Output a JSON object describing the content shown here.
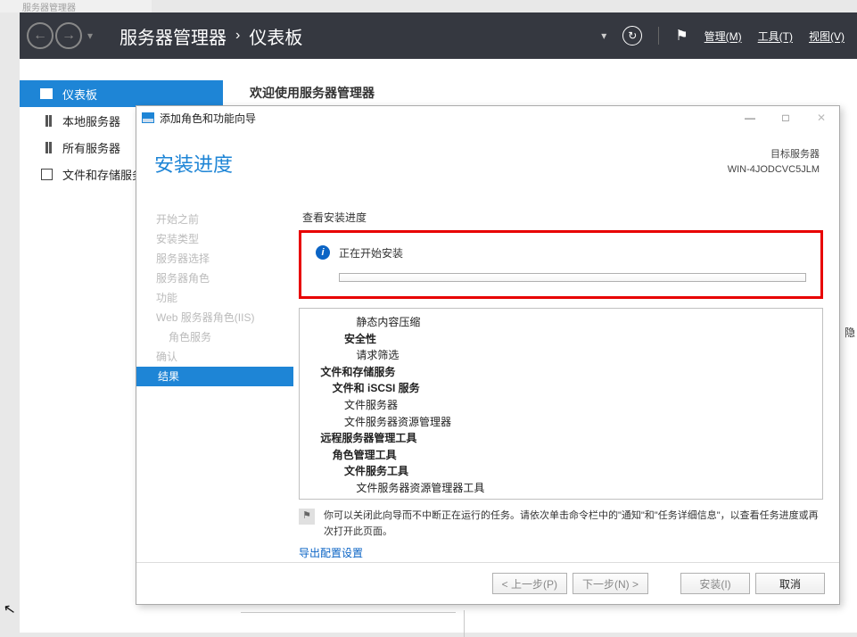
{
  "outerTitle": "服务器管理器",
  "breadcrumb": {
    "app": "服务器管理器",
    "page": "仪表板"
  },
  "headerMenu": {
    "manage": "管理(M)",
    "tools": "工具(T)",
    "view": "视图(V)"
  },
  "sidebar": {
    "items": [
      {
        "label": "仪表板"
      },
      {
        "label": "本地服务器"
      },
      {
        "label": "所有服务器"
      },
      {
        "label": "文件和存储服务"
      }
    ]
  },
  "content": {
    "welcome": "欢迎使用服务器管理器"
  },
  "dialog": {
    "title": "添加角色和功能向导",
    "heading": "安装进度",
    "target": {
      "label": "目标服务器",
      "name": "WIN-4JODCVC5JLM"
    },
    "steps": [
      "开始之前",
      "安装类型",
      "服务器选择",
      "服务器角色",
      "功能",
      "Web 服务器角色(IIS)",
      "角色服务",
      "确认",
      "结果"
    ],
    "sectLabel": "查看安装进度",
    "statusMsg": "正在开始安装",
    "tree": [
      {
        "text": "静态内容压缩",
        "indent": 4
      },
      {
        "text": "安全性",
        "indent": 3,
        "bold": true
      },
      {
        "text": "请求筛选",
        "indent": 4
      },
      {
        "text": "文件和存储服务",
        "indent": 1,
        "bold": true
      },
      {
        "text": "文件和 iSCSI 服务",
        "indent": 2,
        "bold": true
      },
      {
        "text": "文件服务器",
        "indent": 3
      },
      {
        "text": "文件服务器资源管理器",
        "indent": 3
      },
      {
        "text": "远程服务器管理工具",
        "indent": 1,
        "bold": true
      },
      {
        "text": "角色管理工具",
        "indent": 2,
        "bold": true
      },
      {
        "text": "文件服务工具",
        "indent": 3,
        "bold": true
      },
      {
        "text": "文件服务器资源管理器工具",
        "indent": 4
      }
    ],
    "note": "你可以关闭此向导而不中断正在运行的任务。请依次单击命令栏中的\"通知\"和\"任务详细信息\"，以查看任务进度或再次打开此页面。",
    "exportLink": "导出配置设置",
    "buttons": {
      "prev": "< 上一步(P)",
      "next": "下一步(N) >",
      "install": "安装(I)",
      "cancel": "取消"
    }
  },
  "hiddenTab": "隐"
}
